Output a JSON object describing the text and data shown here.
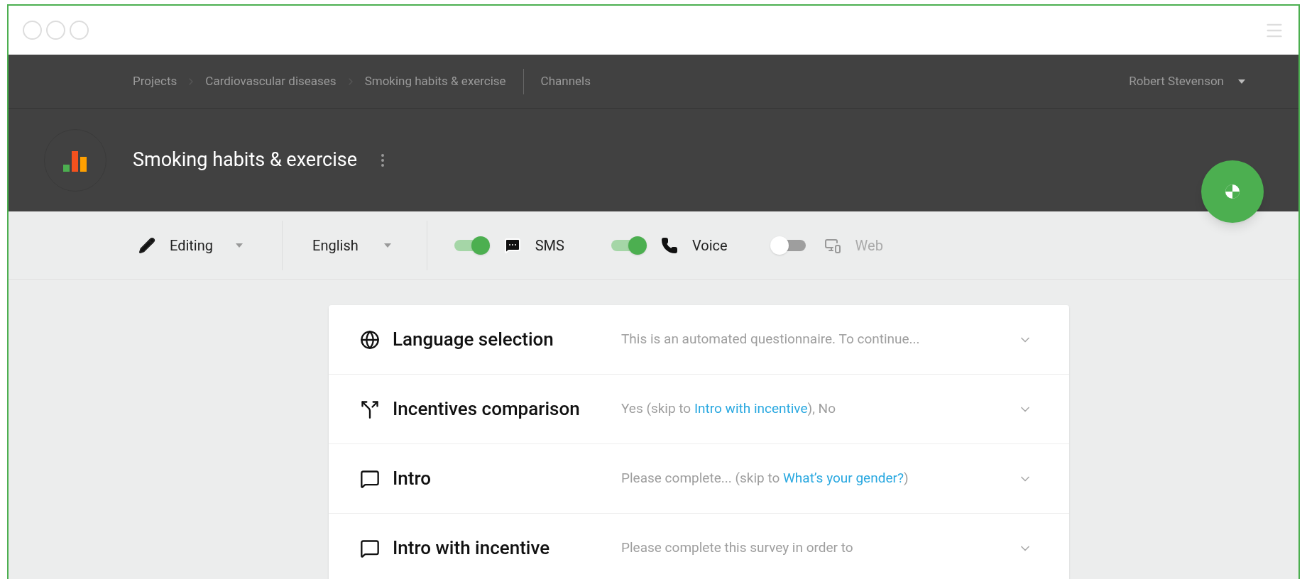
{
  "breadcrumbs": [
    {
      "label": "Projects"
    },
    {
      "label": "Cardiovascular diseases"
    },
    {
      "label": "Smoking habits & exercise"
    }
  ],
  "section_link": "Channels",
  "user": "Robert Stevenson",
  "project_title": "Smoking habits & exercise",
  "toolbar": {
    "mode": "Editing",
    "language": "English"
  },
  "channels": [
    {
      "name": "SMS",
      "kind": "sms",
      "on": true
    },
    {
      "name": "Voice",
      "kind": "voice",
      "on": true
    },
    {
      "name": "Web",
      "kind": "web",
      "on": false
    }
  ],
  "steps": [
    {
      "title": "Language selection",
      "kind": "language",
      "description": [
        {
          "text": "This is an automated questionnaire. To continue..."
        }
      ]
    },
    {
      "title": "Incentives comparison",
      "kind": "branch",
      "description": [
        {
          "text": "Yes (skip to "
        },
        {
          "text": "Intro with incentive",
          "kind": "link"
        },
        {
          "text": "), No"
        }
      ]
    },
    {
      "title": "Intro",
      "kind": "message",
      "description": [
        {
          "text": "Please complete... (skip to "
        },
        {
          "text": "What’s your gender?",
          "kind": "link"
        },
        {
          "text": ")"
        }
      ]
    },
    {
      "title": "Intro with incentive",
      "kind": "message",
      "description": [
        {
          "text": "Please complete this survey in order to"
        }
      ]
    }
  ]
}
